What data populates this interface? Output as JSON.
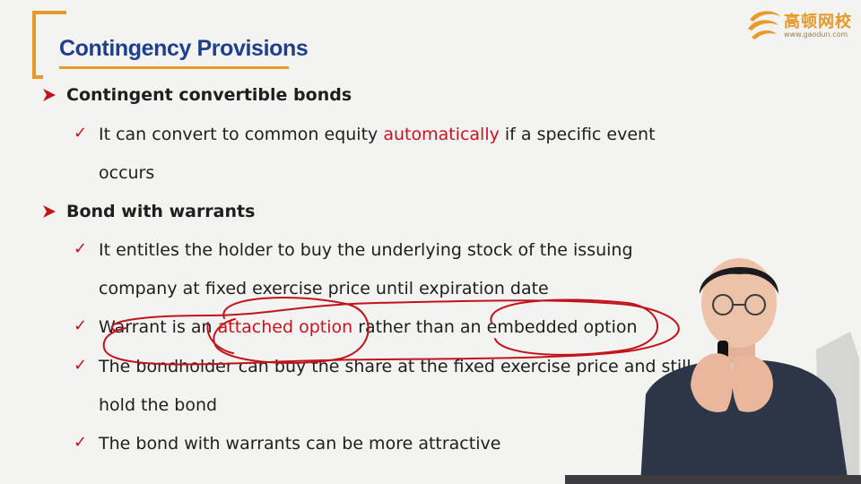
{
  "slide": {
    "title": "Contingency Provisions",
    "logo": {
      "name": "高顿网校",
      "url": "www.gaodun.com"
    },
    "bullets": [
      {
        "heading": "Contingent convertible bonds"
      },
      {
        "pre": "It can convert to common equity ",
        "highlight": "automatically",
        "post": " if a specific event"
      },
      {
        "text": "occurs"
      },
      {
        "heading": "Bond with warrants"
      },
      {
        "text": "It entitles the holder to buy the underlying stock of the issuing"
      },
      {
        "text": "company at fixed exercise price until expiration date"
      },
      {
        "pre": "Warrant is an ",
        "highlight": "attached option",
        "post": " rather than an embedded option"
      },
      {
        "text": "The bondholder can buy the share at the fixed exercise price and still"
      },
      {
        "text": "hold the bond"
      },
      {
        "text": "The bond with warrants can be more attractive"
      }
    ]
  },
  "colors": {
    "title": "#1f3f8c",
    "accent": "#e79a2a",
    "highlight": "#c8141e",
    "ink": "#c0141c"
  }
}
